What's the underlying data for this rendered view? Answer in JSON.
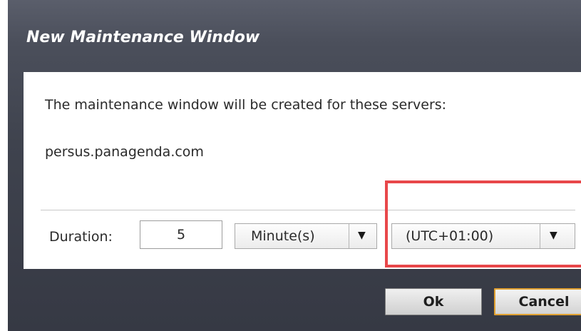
{
  "dialog": {
    "title": "New Maintenance Window",
    "message": "The maintenance window will be created for these servers:",
    "servers": [
      "persus.panagenda.com"
    ]
  },
  "duration": {
    "label": "Duration:",
    "value": "5",
    "unit_selected": "Minute(s)"
  },
  "timezone": {
    "selected": "(UTC+01:00)"
  },
  "buttons": {
    "ok": "Ok",
    "cancel": "Cancel"
  },
  "icons": {
    "dropdown": "chevron-down-icon"
  },
  "colors": {
    "highlight": "#e8474a",
    "focus_border": "#e0a030",
    "dialog_background": "#4b4f5b"
  }
}
